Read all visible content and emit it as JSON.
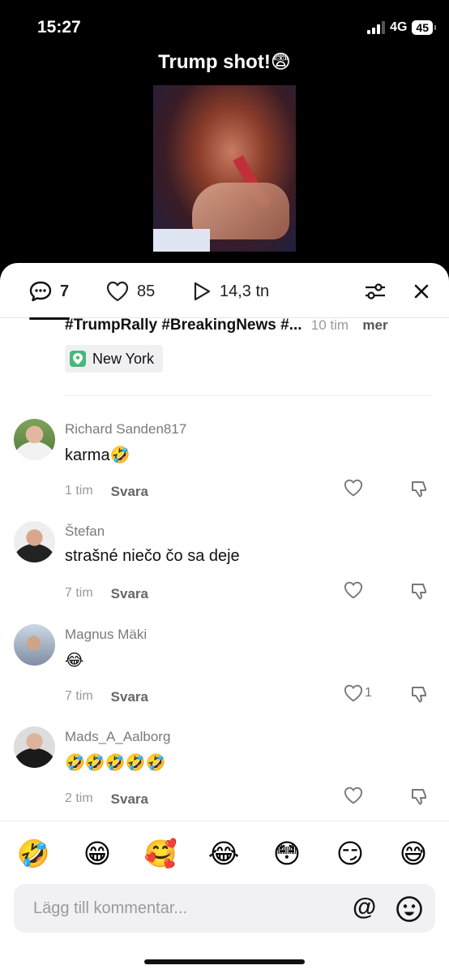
{
  "status_bar": {
    "time": "15:27",
    "network": "4G",
    "battery": "45"
  },
  "video": {
    "title": "Trump shot!😨"
  },
  "header": {
    "comment_count": "7",
    "like_count": "85",
    "view_count": "14,3 tn"
  },
  "caption": {
    "text": "#TrumpRally #BreakingNews #...",
    "time": "10 tim",
    "more": "mer"
  },
  "location": {
    "label": "New York"
  },
  "comments": [
    {
      "user": "Richard Sanden817",
      "text": "karma🤣",
      "time": "1 tim",
      "reply": "Svara",
      "likes": ""
    },
    {
      "user": "Štefan",
      "text": "strašné niečo čo sa deje",
      "time": "7 tim",
      "reply": "Svara",
      "likes": ""
    },
    {
      "user": "Magnus Mäki",
      "text": "😂",
      "time": "7 tim",
      "reply": "Svara",
      "likes": "1"
    },
    {
      "user": "Mads_A_Aalborg",
      "text": "🤣🤣🤣🤣🤣",
      "time": "2 tim",
      "reply": "Svara",
      "likes": ""
    }
  ],
  "emoji_bar": [
    "🤣",
    "😁",
    "🥰",
    "😂",
    "😳",
    "😏",
    "😅"
  ],
  "input": {
    "placeholder": "Lägg till kommentar...",
    "at_symbol": "@"
  },
  "colors": {
    "location_pin": "#48b77b",
    "sheet_bg": "#ffffff",
    "top_bg": "#000000"
  }
}
